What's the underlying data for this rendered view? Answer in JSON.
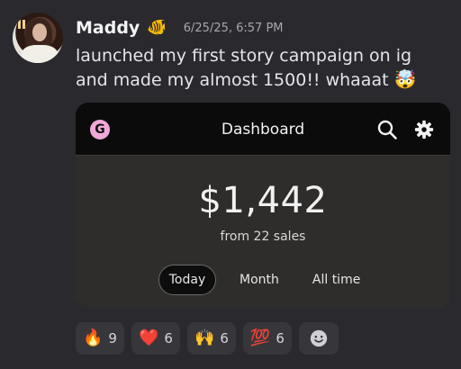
{
  "message": {
    "username": "Maddy",
    "username_badge_icon": "tropical-fish",
    "timestamp": "6/25/25, 6:57 PM",
    "text": "launched my first story campaign on ig and made my almost 1500!! whaaat",
    "text_emoji": "🤯"
  },
  "dashboard": {
    "logo_letter": "G",
    "title": "Dashboard",
    "amount": "$1,442",
    "sales_text": "from 22 sales",
    "tabs": [
      "Today",
      "Month",
      "All time"
    ],
    "active_tab": "Today",
    "logo_color": "#f3a8d9"
  },
  "reactions": [
    {
      "emoji": "🔥",
      "count": "9"
    },
    {
      "emoji": "❤️",
      "count": "6"
    },
    {
      "emoji": "🙌",
      "count": "6"
    },
    {
      "emoji": "💯",
      "count": "6"
    }
  ]
}
